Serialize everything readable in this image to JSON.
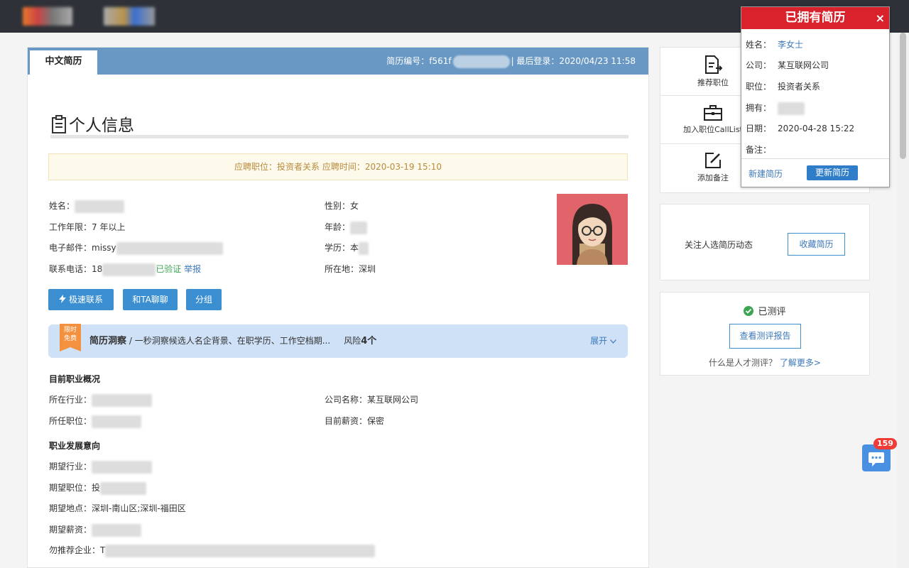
{
  "resume": {
    "tab_label": "中文简历",
    "id_label": "简历编号：",
    "id_prefix": "f561f",
    "last_login": "| 最后登录：2020/04/23 11:58",
    "section_title": "个人信息",
    "notice": "应聘职位：投资者关系 应聘时间：2020-03-19 15:10",
    "fields": {
      "name_label": "姓名：",
      "gender": "性别：女",
      "experience": "工作年限：7 年以上",
      "age_label": "年龄：",
      "email_label": "电子邮件：",
      "email_prefix": "missy",
      "education_label": "学历：",
      "education_prefix": "本",
      "phone_label": "联系电话：",
      "phone_prefix": "18",
      "verified": "已验证",
      "report": "举报",
      "location": "所在地：深圳"
    },
    "buttons": {
      "quick_contact": "极速联系",
      "chat": "和TA聊聊",
      "group": "分组"
    },
    "insight": {
      "badge_line1": "限时",
      "badge_line2": "免费",
      "title": "简历洞察",
      "desc": "/ 一秒洞察候选人名企背景、在职学历、工作空档期...",
      "risk_label": "风险",
      "risk_count": "4个",
      "expand": "展开"
    },
    "current": {
      "heading": "目前职业概况",
      "industry_label": "所在行业：",
      "company": "公司名称：某互联网公司",
      "position_label": "所任职位：",
      "salary": "目前薪资：保密"
    },
    "intent": {
      "heading": "职业发展意向",
      "industry_label": "期望行业：",
      "position_label": "期望职位：",
      "position_prefix": "投",
      "location": "期望地点：深圳-南山区;深圳-福田区",
      "salary_label": "期望薪资：",
      "exclude_label": "勿推荐企业：",
      "exclude_prefix": "T"
    }
  },
  "sidebar": {
    "recommend": "推荐职位",
    "add_calllist": "加入职位CallList",
    "add_note": "添加备注",
    "follow_text": "关注人选简历动态",
    "favorite_button": "收藏简历",
    "assessed": "已测评",
    "view_report": "查看测评报告",
    "what_is": "什么是人才测评？",
    "learn_more": "了解更多>"
  },
  "popup": {
    "title": "已拥有简历",
    "close": "×",
    "name_label": "姓名：",
    "name_value": "李女士",
    "company_label": "公司：",
    "company_value": "某互联网公司",
    "position_label": "职位：",
    "position_value": "投资者关系",
    "owner_label": "拥有：",
    "date_label": "日期：",
    "date_value": "2020-04-28 15:22",
    "note_label": "备注：",
    "new_resume": "新建简历",
    "update_resume": "更新简历"
  },
  "chat": {
    "badge": "159"
  },
  "colors": {
    "header_blue": "#6a98c4",
    "button_blue": "#3b8fd0",
    "popup_red": "#d9222b",
    "verified_green": "#3ba554"
  }
}
